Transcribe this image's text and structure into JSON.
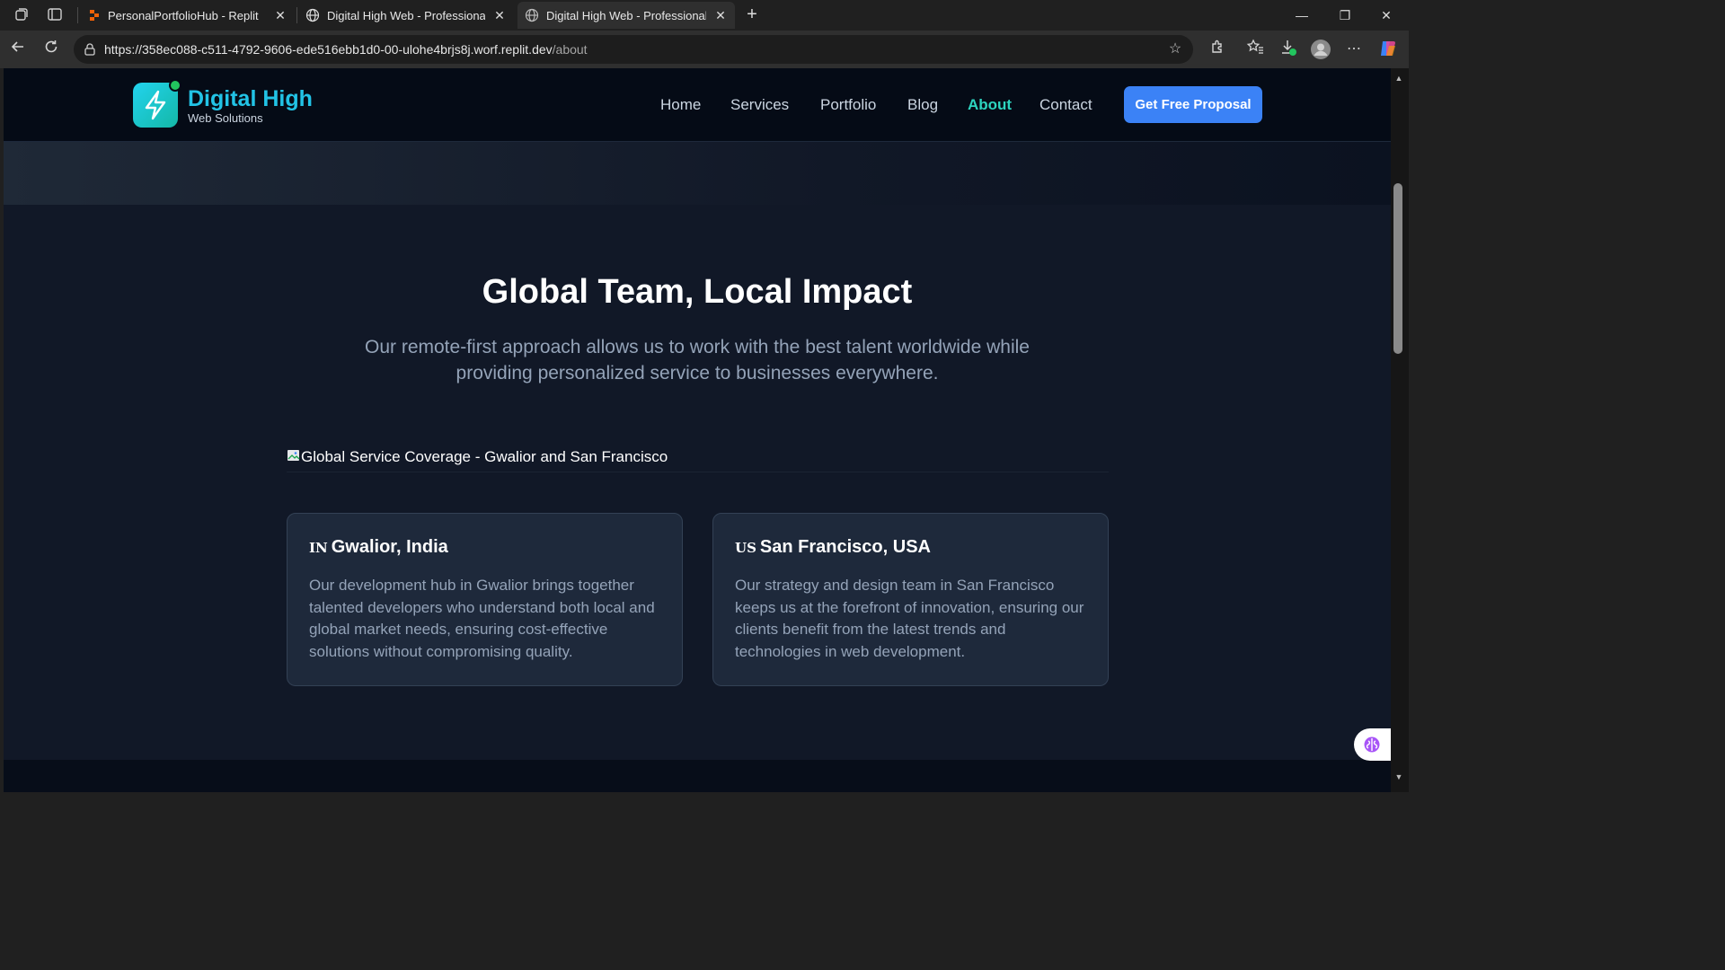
{
  "browser": {
    "tabs": [
      {
        "title": "PersonalPortfolioHub - Replit",
        "close": "✕"
      },
      {
        "title": "Digital High Web - Professional W",
        "close": "✕"
      },
      {
        "title": "Digital High Web - Professional W",
        "close": "✕"
      }
    ],
    "new_tab": "+",
    "url_host": "https://358ec088-c511-4792-9606-ede516ebb1d0-00-ulohe4brjs8j.worf.replit.dev",
    "url_path": "/about",
    "window_controls": [
      "—",
      "❐",
      "✕"
    ]
  },
  "site": {
    "brand": "Digital High",
    "brand_sub": "Web Solutions",
    "nav": [
      "Home",
      "Services",
      "Portfolio",
      "Blog",
      "About",
      "Contact"
    ],
    "active_nav": "About",
    "cta": "Get Free Proposal",
    "colors": {
      "brand": "#22c3e6",
      "active": "#2dd4bf",
      "cta": "#3b82f6",
      "background": "#111827"
    }
  },
  "section": {
    "title": "Global Team, Local Impact",
    "subtitle": "Our remote-first approach allows us to work with the best talent worldwide while providing personalized service to businesses everywhere.",
    "image_alt": "Global Service Coverage - Gwalior and San Francisco"
  },
  "cards": [
    {
      "flag": "IN",
      "title": "Gwalior, India",
      "body": "Our development hub in Gwalior brings together talented developers who understand both local and global market needs, ensuring cost-effective solutions without compromising quality."
    },
    {
      "flag": "US",
      "title": "San Francisco, USA",
      "body": "Our strategy and design team in San Francisco keeps us at the forefront of innovation, ensuring our clients benefit from the latest trends and technologies in web development."
    }
  ]
}
